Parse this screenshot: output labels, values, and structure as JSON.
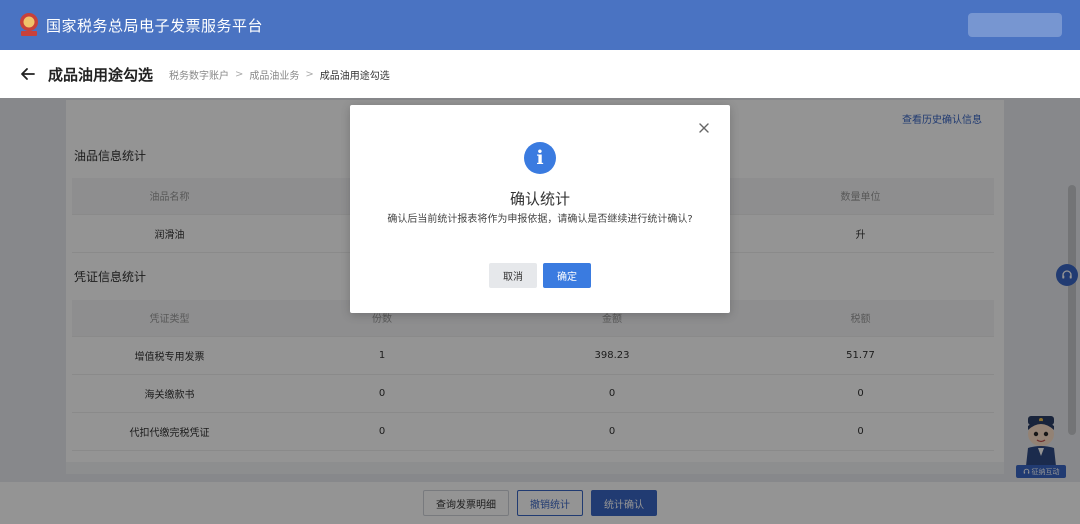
{
  "topbar": {
    "title": "国家税务总局电子发票服务平台",
    "emblem_color": "#c8413a"
  },
  "header": {
    "page_title": "成品油用途勾选",
    "breadcrumb": [
      "税务数字账户",
      "成品油业务",
      "成品油用途勾选"
    ]
  },
  "content": {
    "history_link": "查看历史确认信息",
    "oil_section": {
      "title": "油品信息统计",
      "headers": [
        "油品名称",
        "",
        "",
        "数量单位"
      ],
      "rows": [
        [
          "润滑油",
          "",
          "",
          "升"
        ]
      ]
    },
    "voucher_section": {
      "title": "凭证信息统计",
      "headers": [
        "凭证类型",
        "份数",
        "金额",
        "税额"
      ],
      "rows": [
        [
          "增值税专用发票",
          "1",
          "398.23",
          "51.77"
        ],
        [
          "海关缴款书",
          "0",
          "0",
          "0"
        ],
        [
          "代扣代缴完税凭证",
          "0",
          "0",
          "0"
        ]
      ]
    }
  },
  "bottombar": {
    "query_detail": "查询发票明细",
    "revoke_stats": "撤销统计",
    "confirm_stats": "统计确认"
  },
  "widgets": {
    "mascot_label": "征纳互动"
  },
  "modal": {
    "icon": "info-icon",
    "title": "确认统计",
    "message": "确认后当前统计报表将作为申报依据，请确认是否继续进行统计确认?",
    "cancel": "取消",
    "ok": "确定"
  },
  "colors": {
    "primary": "#3a66c4",
    "topbar": "#4a73c2",
    "info": "#3a7be0"
  }
}
